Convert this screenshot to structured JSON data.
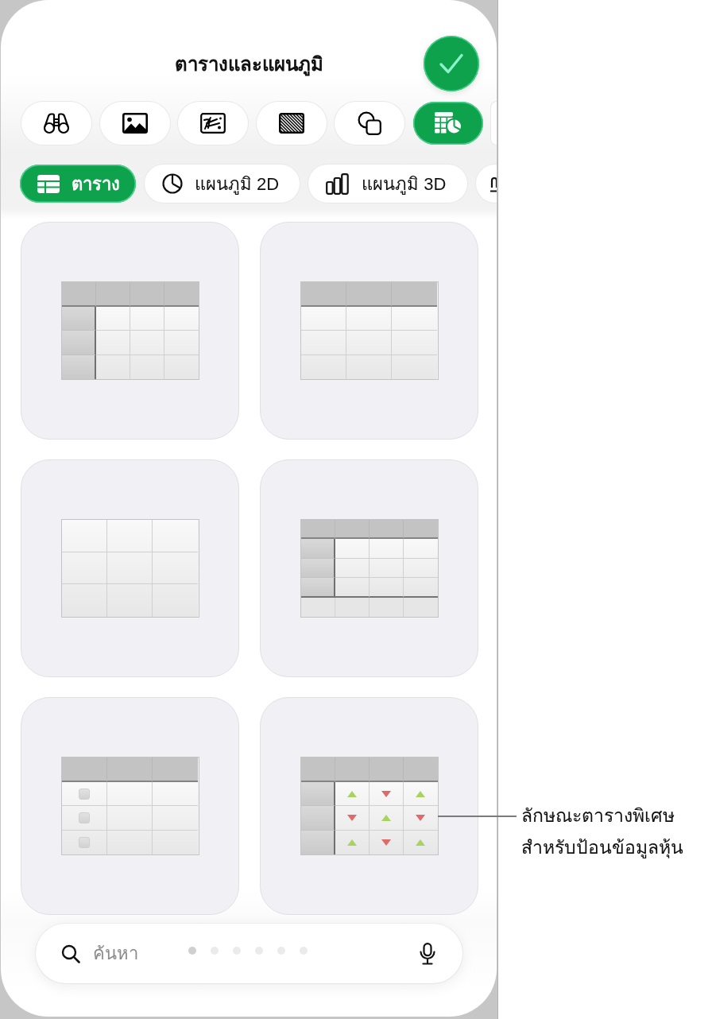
{
  "header": {
    "title": "ตารางและแผนภูมิ"
  },
  "insert_tabs": [
    {
      "selected": false
    },
    {
      "selected": false
    },
    {
      "selected": false
    },
    {
      "selected": false
    },
    {
      "selected": false
    },
    {
      "selected": true
    },
    {
      "selected": false
    }
  ],
  "categories": [
    {
      "label": "ตาราง",
      "selected": true
    },
    {
      "label": "แผนภูมิ 2D",
      "selected": false
    },
    {
      "label": "แผนภูมิ 3D",
      "selected": false
    },
    {
      "selected": false
    }
  ],
  "table_styles": [
    {
      "kind": "headers"
    },
    {
      "kind": "toprow"
    },
    {
      "kind": "plain"
    },
    {
      "kind": "footer"
    },
    {
      "kind": "checklist"
    },
    {
      "kind": "stocks"
    }
  ],
  "search": {
    "placeholder": "ค้นหา"
  },
  "page_dots": [
    {
      "selected": true
    },
    {
      "selected": false
    },
    {
      "selected": false
    },
    {
      "selected": false
    },
    {
      "selected": false
    },
    {
      "selected": false
    }
  ],
  "callout": {
    "text": "ลักษณะตารางพิเศษ\nสำหรับป้อนข้อมูลหุ้น"
  }
}
